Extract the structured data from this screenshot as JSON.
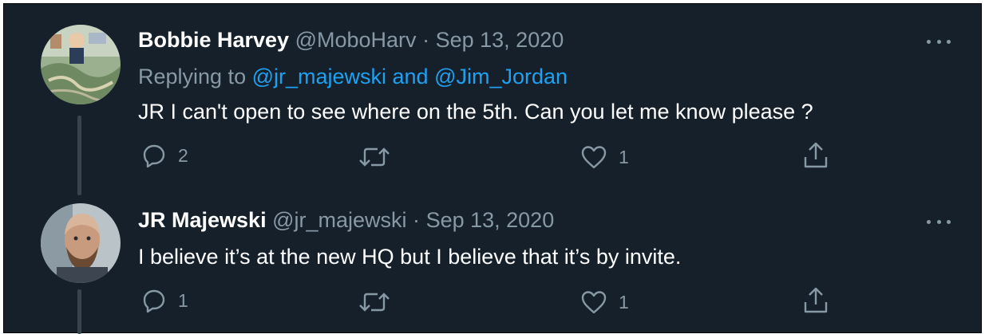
{
  "tweets": [
    {
      "display_name": "Bobbie Harvey",
      "handle": "@MoboHarv",
      "separator": "·",
      "date": "Sep 13, 2020",
      "replying_prefix": "Replying to ",
      "replying_mentions": "@jr_majewski and @Jim_Jordan",
      "text": "JR I can't open to see where on the 5th.  Can you let me know please  ?",
      "reply_count": "2",
      "retweet_count": "",
      "like_count": "1",
      "avatar_icon": "collage-avatar"
    },
    {
      "display_name": "JR Majewski",
      "handle": "@jr_majewski",
      "separator": "·",
      "date": "Sep 13, 2020",
      "text": "I believe it’s at the new HQ but I believe that it’s by invite.",
      "reply_count": "1",
      "retweet_count": "",
      "like_count": "1",
      "avatar_icon": "portrait-avatar"
    }
  ],
  "colors": {
    "background": "#15202b",
    "text": "#ffffff",
    "secondary": "#8899a6",
    "link": "#1da1f2",
    "thread_line": "#38444d"
  },
  "icons": [
    "reply-icon",
    "retweet-icon",
    "like-icon",
    "share-icon",
    "more-icon"
  ]
}
